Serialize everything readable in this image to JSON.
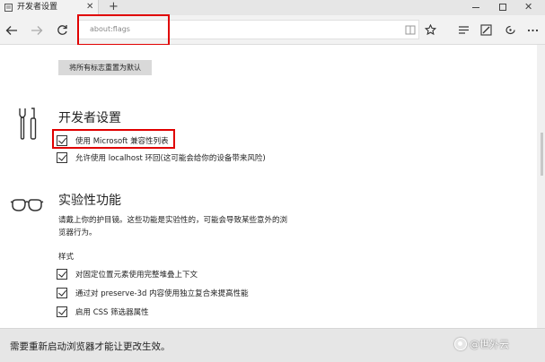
{
  "tab": {
    "title": "开发者设置",
    "close_glyph": "✕",
    "new_tab_glyph": "+"
  },
  "window": {
    "close_glyph": "✕"
  },
  "address": {
    "value": "about:flags"
  },
  "toolbar_icons": [
    "back-icon",
    "forward-icon",
    "refresh-icon",
    "reading-view-icon",
    "favorite-star-icon",
    "hub-icon",
    "web-note-icon",
    "share-icon",
    "more-icon"
  ],
  "reset_button": {
    "label": "将所有标志重置为默认"
  },
  "developer_settings": {
    "title": "开发者设置",
    "options": [
      {
        "label": "使用 Microsoft 兼容性列表",
        "checked": true
      },
      {
        "label": "允许使用 localhost 环回(这可能会给你的设备带来风险)",
        "checked": true
      }
    ]
  },
  "experimental": {
    "title": "实验性功能",
    "description": "请戴上你的护目镜。这些功能是实验性的，可能会导致某些意外的浏览器行为。",
    "subheading": "样式",
    "options": [
      {
        "label": "对固定位置元素使用完整堆叠上下文",
        "checked": true
      },
      {
        "label": "通过对 preserve-3d 内容使用独立复合来提高性能",
        "checked": true
      },
      {
        "label": "启用 CSS 筛选器属性",
        "checked": true
      }
    ]
  },
  "notification": {
    "text": "需要重新启动浏览器才能让更改生效。"
  },
  "watermark": {
    "text": "@世外云"
  },
  "colors": {
    "highlight_red": "#e00000",
    "chrome_gray": "#f2f2f2",
    "notify_gray": "#e6e6e6"
  }
}
